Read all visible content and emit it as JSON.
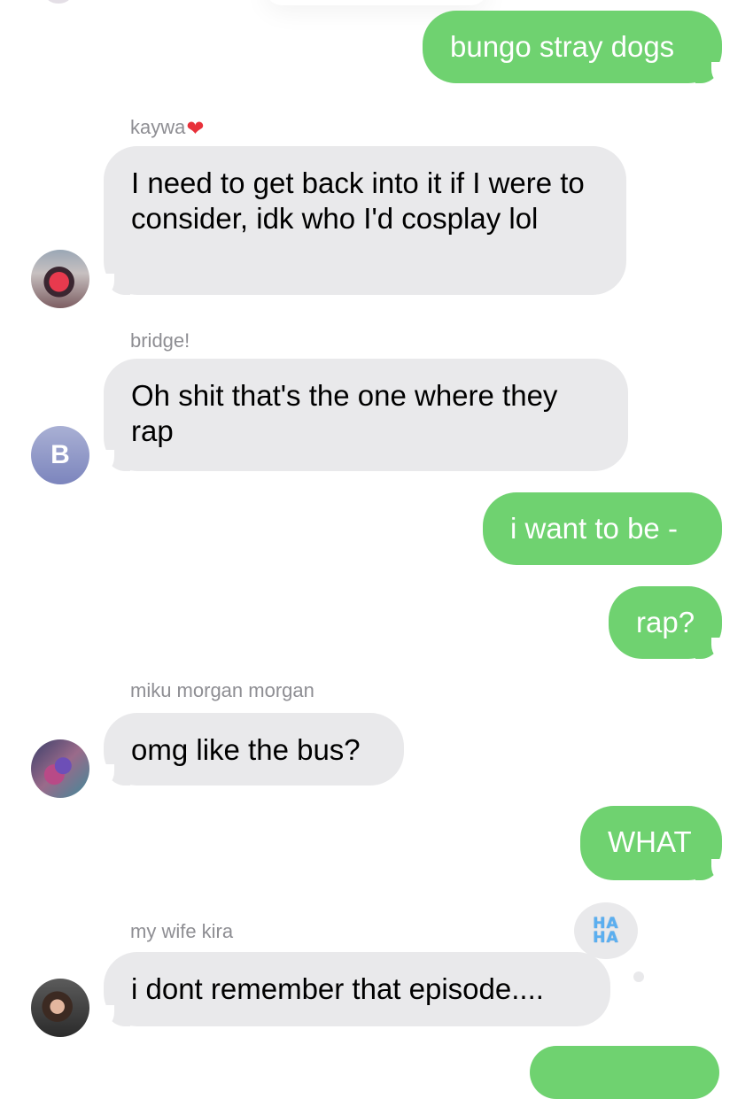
{
  "colors": {
    "sent_bubble": "#6fd270",
    "received_bubble": "#e9e9eb",
    "sender_label": "#8e8e93",
    "tapback_text": "#5aaff0"
  },
  "messages": [
    {
      "direction": "sent",
      "text": "bungo stray dogs"
    },
    {
      "direction": "received",
      "sender": "kaywa",
      "sender_emoji": "❤️",
      "avatar": "photo-avatar-icon",
      "text": "I need to get back into it if I were to consider, idk who I'd cosplay lol"
    },
    {
      "direction": "received",
      "sender": "bridge!",
      "avatar_initial": "B",
      "text": "Oh shit that's the one where they rap"
    },
    {
      "direction": "sent",
      "text": "i want to be -"
    },
    {
      "direction": "sent",
      "text": "rap?"
    },
    {
      "direction": "received",
      "sender": "miku morgan morgan",
      "avatar": "photo-avatar-icon",
      "text": "omg like the bus?"
    },
    {
      "direction": "sent",
      "text": "WHAT"
    },
    {
      "direction": "received",
      "sender": "my wife kira",
      "avatar": "photo-avatar-icon",
      "text": "i dont remember that episode....",
      "tapback": {
        "icon": "haha-tapback-icon",
        "line1": "HA",
        "line2": "HA"
      }
    }
  ]
}
